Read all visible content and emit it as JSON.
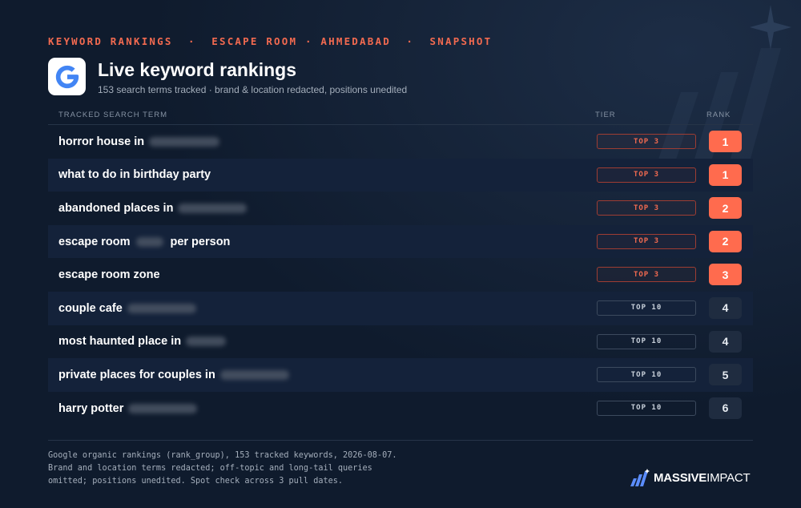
{
  "eyebrow": "KEYWORD RANKINGS  ·  ESCAPE ROOM · AHMEDABAD  ·  SNAPSHOT",
  "header": {
    "title": "Live keyword rankings",
    "subtitle": "153 search terms tracked · brand & location redacted, positions unedited"
  },
  "columns": {
    "term": "TRACKED SEARCH TERM",
    "tier": "TIER",
    "rank": "RANK"
  },
  "rows": [
    {
      "term": "horror house in",
      "suffix": "",
      "tier": "TOP 3",
      "rank": "1"
    },
    {
      "term": "what to do in birthday party",
      "suffix": "",
      "tier": "TOP 3",
      "rank": "1"
    },
    {
      "term": "abandoned places in",
      "suffix": "",
      "tier": "TOP 3",
      "rank": "2"
    },
    {
      "term": "escape room",
      "suffix": "per person",
      "tier": "TOP 3",
      "rank": "2"
    },
    {
      "term": "escape room zone",
      "suffix": "",
      "tier": "TOP 3",
      "rank": "3"
    },
    {
      "term": "couple cafe",
      "suffix": "",
      "tier": "TOP 10",
      "rank": "4"
    },
    {
      "term": "most haunted place in",
      "suffix": "",
      "tier": "TOP 10",
      "rank": "4"
    },
    {
      "term": "private places for couples in",
      "suffix": "",
      "tier": "TOP 10",
      "rank": "5"
    },
    {
      "term": "harry potter",
      "suffix": "",
      "tier": "TOP 10",
      "rank": "6"
    }
  ],
  "footnote": [
    "Google organic rankings (rank_group), 153 tracked keywords, 2026-08-07.",
    "Brand and location terms redacted; off-topic and long-tail queries",
    "omitted; positions unedited. Spot check across 3 pull dates."
  ],
  "brand": {
    "bold": "MASSIVE",
    "light": "IMPACT"
  },
  "colors": {
    "background": "#0f1b2d",
    "accent": "#ff6b4e",
    "eyebrow": "#f26a50",
    "muted": "#a4aebb"
  },
  "icons": {
    "logo": "google-g-icon",
    "brand": "massive-impact-logo-icon"
  }
}
